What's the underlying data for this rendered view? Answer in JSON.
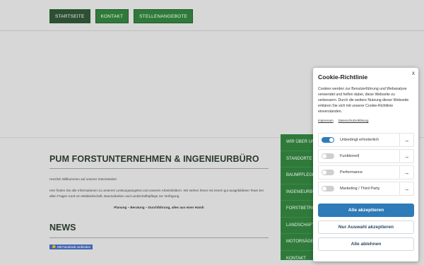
{
  "nav": {
    "items": [
      {
        "label": "STARTSEITE",
        "active": true
      },
      {
        "label": "KONTAKT"
      },
      {
        "label": "STELLENANGEBOTE"
      }
    ]
  },
  "content": {
    "title": "PUM FORSTUNTERNEHMEN & INGENIEURBÜRO",
    "welcome": "Herzlich Willkommen auf unserer Internetseite!",
    "intro": "Hier finden Sie alle Informationen zu unserem Leistungsangebot und unseren Arbeitsfeldern. Wir stehen Ihnen mit einem gut ausgebildeten Team bei allen Fragen rund um Waldwirtschaft, Baumarbeiten und Landschaftspflege zur Verfügung.",
    "tagline": "Planung – Beratung – Durchführung, alles aus einer Hand!",
    "news_title": "NEWS",
    "facebook_button": "Mit Facebook verbinden"
  },
  "sidemenu": {
    "items": [
      "WIR ÜBER UNS",
      "STANDORTE",
      "BAUMPFLEGE",
      "INGENIEURBÜRO",
      "FORSTBETRIEB",
      "LANDSCHAFTSPFLEGE",
      "MOTORSÄGENKURSE",
      "KONTAKT"
    ]
  },
  "cookie": {
    "title": "Cookie-Richtlinie",
    "close": "x",
    "text": "Cookies werden zur Benutzerführung und Webanalyse verwendet und helfen dabei, diese Webseite zu verbessern. Durch die weitere Nutzung dieser Webseite erklären Sie sich mit unserer Cookie-Richtlinie einverstanden.",
    "links": {
      "impressum": "Impressum",
      "datenschutz": "Datenschutzerklärung"
    },
    "options": [
      {
        "label": "Unbedingt erforderlich",
        "on": true
      },
      {
        "label": "Funktionell",
        "on": false
      },
      {
        "label": "Performance",
        "on": false
      },
      {
        "label": "Marketing / Third Party",
        "on": false
      }
    ],
    "arrow": "→",
    "buttons": {
      "accept_all": "Alle akzeptieren",
      "accept_selection": "Nur Auswahl akzeptieren",
      "reject_all": "Alle ablehnen"
    },
    "accent_color": "#2d7bb8"
  },
  "colors": {
    "brand_green": "#2f7a3a",
    "background": "#d7d7d7"
  },
  "icons": {
    "facebook": "facebook-icon",
    "close": "close-icon",
    "arrow": "arrow-right-icon"
  }
}
